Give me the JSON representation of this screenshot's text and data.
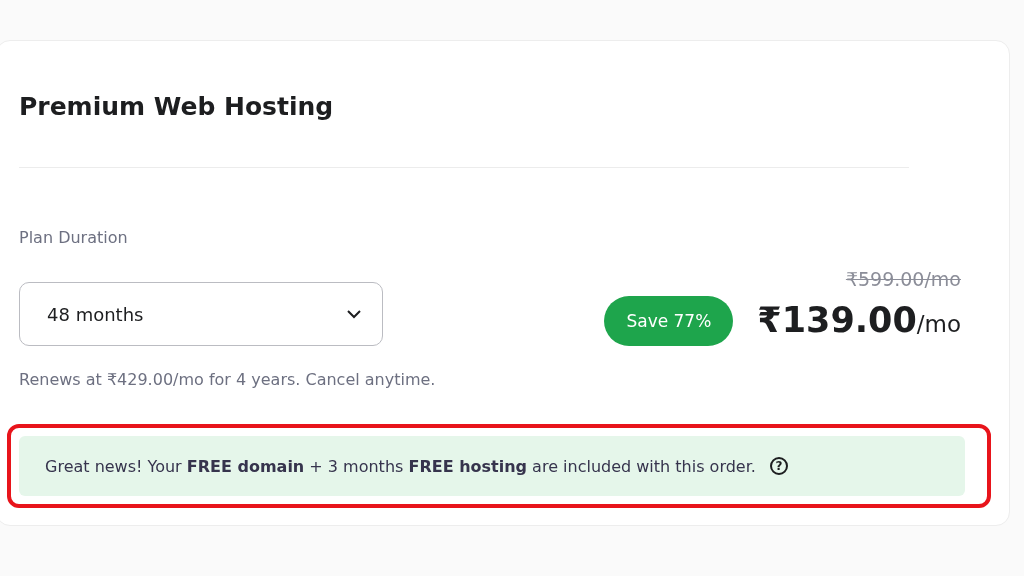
{
  "plan": {
    "title": "Premium Web Hosting",
    "duration_label": "Plan Duration",
    "duration_value": "48 months",
    "renewal": "Renews at ₹429.00/mo for 4 years. Cancel anytime.",
    "badge": "Save 77%",
    "old_price": "₹599.00/mo",
    "price": "₹139.00",
    "price_unit": "/mo"
  },
  "notice": {
    "text": "Great news! Your **FREE domain** + 3 months **FREE hosting** are included with this order.",
    "help_icon": "?",
    "highlighted": true
  }
}
